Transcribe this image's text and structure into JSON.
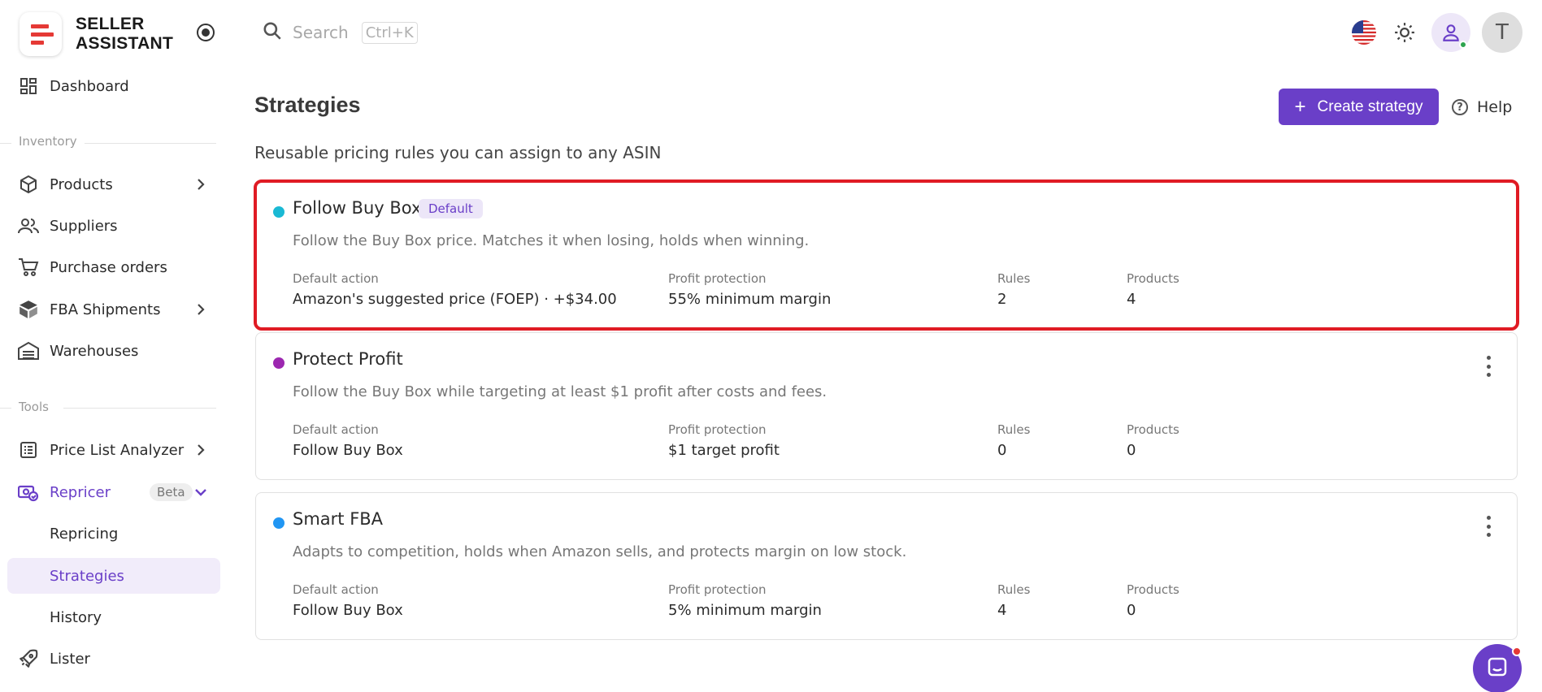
{
  "brand": {
    "line1": "SELLER",
    "line2": "ASSISTANT"
  },
  "header": {
    "search_placeholder": "Search",
    "shortcut": "Ctrl+K",
    "avatar_initial": "T"
  },
  "sidebar": {
    "dashboard": "Dashboard",
    "section_inventory": "Inventory",
    "products": "Products",
    "suppliers": "Suppliers",
    "purchase_orders": "Purchase orders",
    "fba_shipments": "FBA Shipments",
    "warehouses": "Warehouses",
    "section_tools": "Tools",
    "price_list_analyzer": "Price List Analyzer",
    "repricer": "Repricer",
    "repricer_badge": "Beta",
    "repricing": "Repricing",
    "strategies": "Strategies",
    "history": "History",
    "lister": "Lister"
  },
  "main": {
    "title": "Strategies",
    "subtitle": "Reusable pricing rules you can assign to any ASIN",
    "create_label": "Create strategy",
    "help_label": "Help",
    "col_labels": {
      "action": "Default action",
      "protection": "Profit protection",
      "rules": "Rules",
      "products": "Products"
    },
    "strategies": [
      {
        "name": "Follow Buy Box",
        "badge": "Default",
        "color": "#1ab9d4",
        "description": "Follow the Buy Box price. Matches it when losing, holds when winning.",
        "action": "Amazon's suggested price (FOEP) · +$34.00",
        "protection": "55% minimum margin",
        "rules": "2",
        "products": "4"
      },
      {
        "name": "Protect Profit",
        "color": "#9c27b0",
        "description": "Follow the Buy Box while targeting at least $1 profit after costs and fees.",
        "action": "Follow Buy Box",
        "protection": "$1 target profit",
        "rules": "0",
        "products": "0"
      },
      {
        "name": "Smart FBA",
        "color": "#2196f3",
        "description": "Adapts to competition, holds when Amazon sells, and protects margin on low stock.",
        "action": "Follow Buy Box",
        "protection": "5% minimum margin",
        "rules": "4",
        "products": "0"
      }
    ]
  },
  "colors": {
    "accent": "#6a3fc8",
    "highlight": "#e01b24"
  }
}
